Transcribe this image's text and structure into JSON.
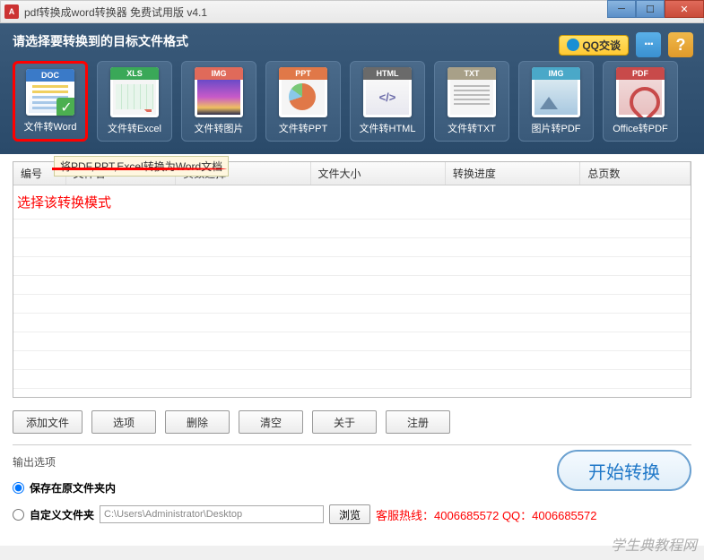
{
  "titlebar": {
    "title": "pdf转换成word转换器 免费试用版 v4.1"
  },
  "header": {
    "title": "请选择要转换到的目标文件格式",
    "qq_label": "QQ交谈",
    "help_label": "?",
    "chat_label": "···"
  },
  "formats": [
    {
      "tag": "DOC",
      "label": "文件转Word",
      "selected": true,
      "cls": "doc"
    },
    {
      "tag": "XLS",
      "label": "文件转Excel",
      "selected": false,
      "cls": "xls"
    },
    {
      "tag": "IMG",
      "label": "文件转图片",
      "selected": false,
      "cls": "img"
    },
    {
      "tag": "PPT",
      "label": "文件转PPT",
      "selected": false,
      "cls": "ppt"
    },
    {
      "tag": "HTML",
      "label": "文件转HTML",
      "selected": false,
      "cls": "html"
    },
    {
      "tag": "TXT",
      "label": "文件转TXT",
      "selected": false,
      "cls": "txt"
    },
    {
      "tag": "IMG",
      "label": "图片转PDF",
      "selected": false,
      "cls": "img2"
    },
    {
      "tag": "PDF",
      "label": "Office转PDF",
      "selected": false,
      "cls": "pdf"
    }
  ],
  "tooltip": "将PDF,PPT,Excel转换为Word文档",
  "annotation": "选择该转换模式",
  "columns": [
    "编号",
    "文件名",
    "页数选择",
    "文件大小",
    "转换进度",
    "总页数"
  ],
  "buttons": {
    "add": "添加文件",
    "options": "选项",
    "delete": "删除",
    "clear": "清空",
    "about": "关于",
    "register": "注册"
  },
  "output": {
    "title": "输出选项",
    "save_same": "保存在原文件夹内",
    "custom_folder": "自定义文件夹",
    "path": "C:\\Users\\Administrator\\Desktop",
    "browse": "浏览",
    "hotline": "客服热线：4006685572 QQ：4006685572"
  },
  "start": "开始转换",
  "watermark": "学生典教程网"
}
